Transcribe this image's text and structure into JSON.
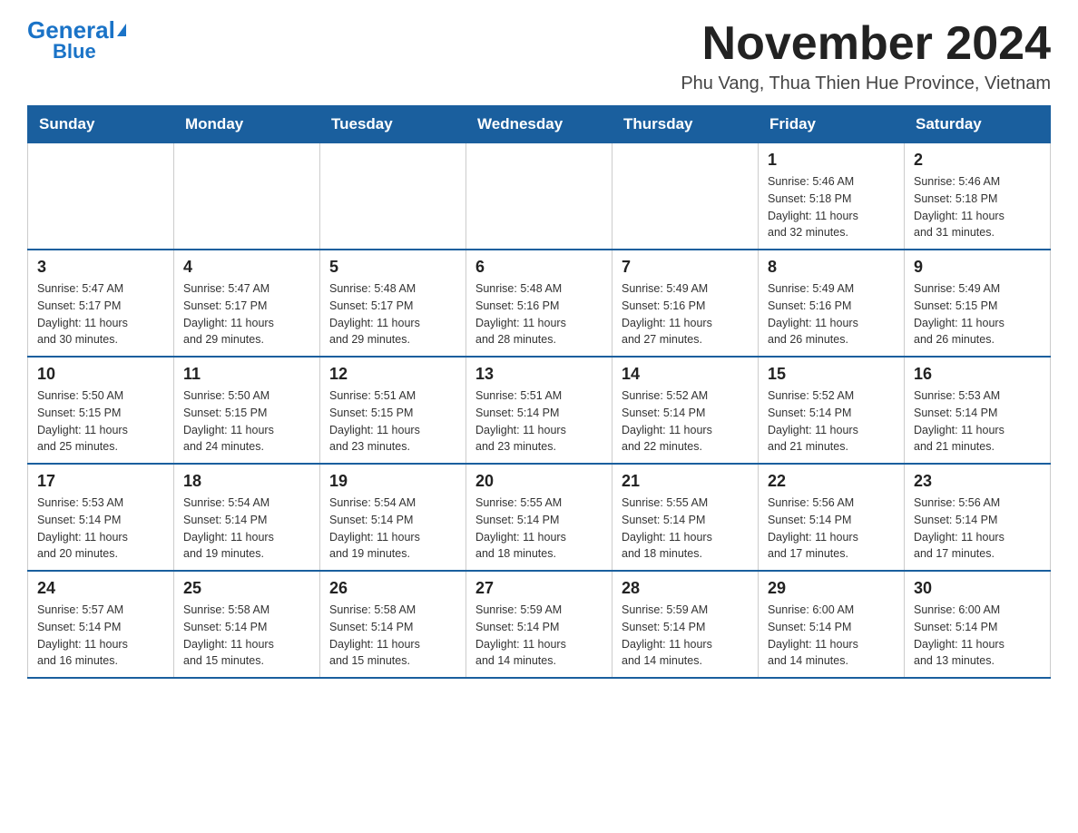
{
  "logo": {
    "general": "General",
    "triangle": "▶",
    "blue": "Blue"
  },
  "header": {
    "title": "November 2024",
    "subtitle": "Phu Vang, Thua Thien Hue Province, Vietnam"
  },
  "weekdays": [
    "Sunday",
    "Monday",
    "Tuesday",
    "Wednesday",
    "Thursday",
    "Friday",
    "Saturday"
  ],
  "weeks": [
    [
      {
        "day": "",
        "info": ""
      },
      {
        "day": "",
        "info": ""
      },
      {
        "day": "",
        "info": ""
      },
      {
        "day": "",
        "info": ""
      },
      {
        "day": "",
        "info": ""
      },
      {
        "day": "1",
        "info": "Sunrise: 5:46 AM\nSunset: 5:18 PM\nDaylight: 11 hours\nand 32 minutes."
      },
      {
        "day": "2",
        "info": "Sunrise: 5:46 AM\nSunset: 5:18 PM\nDaylight: 11 hours\nand 31 minutes."
      }
    ],
    [
      {
        "day": "3",
        "info": "Sunrise: 5:47 AM\nSunset: 5:17 PM\nDaylight: 11 hours\nand 30 minutes."
      },
      {
        "day": "4",
        "info": "Sunrise: 5:47 AM\nSunset: 5:17 PM\nDaylight: 11 hours\nand 29 minutes."
      },
      {
        "day": "5",
        "info": "Sunrise: 5:48 AM\nSunset: 5:17 PM\nDaylight: 11 hours\nand 29 minutes."
      },
      {
        "day": "6",
        "info": "Sunrise: 5:48 AM\nSunset: 5:16 PM\nDaylight: 11 hours\nand 28 minutes."
      },
      {
        "day": "7",
        "info": "Sunrise: 5:49 AM\nSunset: 5:16 PM\nDaylight: 11 hours\nand 27 minutes."
      },
      {
        "day": "8",
        "info": "Sunrise: 5:49 AM\nSunset: 5:16 PM\nDaylight: 11 hours\nand 26 minutes."
      },
      {
        "day": "9",
        "info": "Sunrise: 5:49 AM\nSunset: 5:15 PM\nDaylight: 11 hours\nand 26 minutes."
      }
    ],
    [
      {
        "day": "10",
        "info": "Sunrise: 5:50 AM\nSunset: 5:15 PM\nDaylight: 11 hours\nand 25 minutes."
      },
      {
        "day": "11",
        "info": "Sunrise: 5:50 AM\nSunset: 5:15 PM\nDaylight: 11 hours\nand 24 minutes."
      },
      {
        "day": "12",
        "info": "Sunrise: 5:51 AM\nSunset: 5:15 PM\nDaylight: 11 hours\nand 23 minutes."
      },
      {
        "day": "13",
        "info": "Sunrise: 5:51 AM\nSunset: 5:14 PM\nDaylight: 11 hours\nand 23 minutes."
      },
      {
        "day": "14",
        "info": "Sunrise: 5:52 AM\nSunset: 5:14 PM\nDaylight: 11 hours\nand 22 minutes."
      },
      {
        "day": "15",
        "info": "Sunrise: 5:52 AM\nSunset: 5:14 PM\nDaylight: 11 hours\nand 21 minutes."
      },
      {
        "day": "16",
        "info": "Sunrise: 5:53 AM\nSunset: 5:14 PM\nDaylight: 11 hours\nand 21 minutes."
      }
    ],
    [
      {
        "day": "17",
        "info": "Sunrise: 5:53 AM\nSunset: 5:14 PM\nDaylight: 11 hours\nand 20 minutes."
      },
      {
        "day": "18",
        "info": "Sunrise: 5:54 AM\nSunset: 5:14 PM\nDaylight: 11 hours\nand 19 minutes."
      },
      {
        "day": "19",
        "info": "Sunrise: 5:54 AM\nSunset: 5:14 PM\nDaylight: 11 hours\nand 19 minutes."
      },
      {
        "day": "20",
        "info": "Sunrise: 5:55 AM\nSunset: 5:14 PM\nDaylight: 11 hours\nand 18 minutes."
      },
      {
        "day": "21",
        "info": "Sunrise: 5:55 AM\nSunset: 5:14 PM\nDaylight: 11 hours\nand 18 minutes."
      },
      {
        "day": "22",
        "info": "Sunrise: 5:56 AM\nSunset: 5:14 PM\nDaylight: 11 hours\nand 17 minutes."
      },
      {
        "day": "23",
        "info": "Sunrise: 5:56 AM\nSunset: 5:14 PM\nDaylight: 11 hours\nand 17 minutes."
      }
    ],
    [
      {
        "day": "24",
        "info": "Sunrise: 5:57 AM\nSunset: 5:14 PM\nDaylight: 11 hours\nand 16 minutes."
      },
      {
        "day": "25",
        "info": "Sunrise: 5:58 AM\nSunset: 5:14 PM\nDaylight: 11 hours\nand 15 minutes."
      },
      {
        "day": "26",
        "info": "Sunrise: 5:58 AM\nSunset: 5:14 PM\nDaylight: 11 hours\nand 15 minutes."
      },
      {
        "day": "27",
        "info": "Sunrise: 5:59 AM\nSunset: 5:14 PM\nDaylight: 11 hours\nand 14 minutes."
      },
      {
        "day": "28",
        "info": "Sunrise: 5:59 AM\nSunset: 5:14 PM\nDaylight: 11 hours\nand 14 minutes."
      },
      {
        "day": "29",
        "info": "Sunrise: 6:00 AM\nSunset: 5:14 PM\nDaylight: 11 hours\nand 14 minutes."
      },
      {
        "day": "30",
        "info": "Sunrise: 6:00 AM\nSunset: 5:14 PM\nDaylight: 11 hours\nand 13 minutes."
      }
    ]
  ]
}
